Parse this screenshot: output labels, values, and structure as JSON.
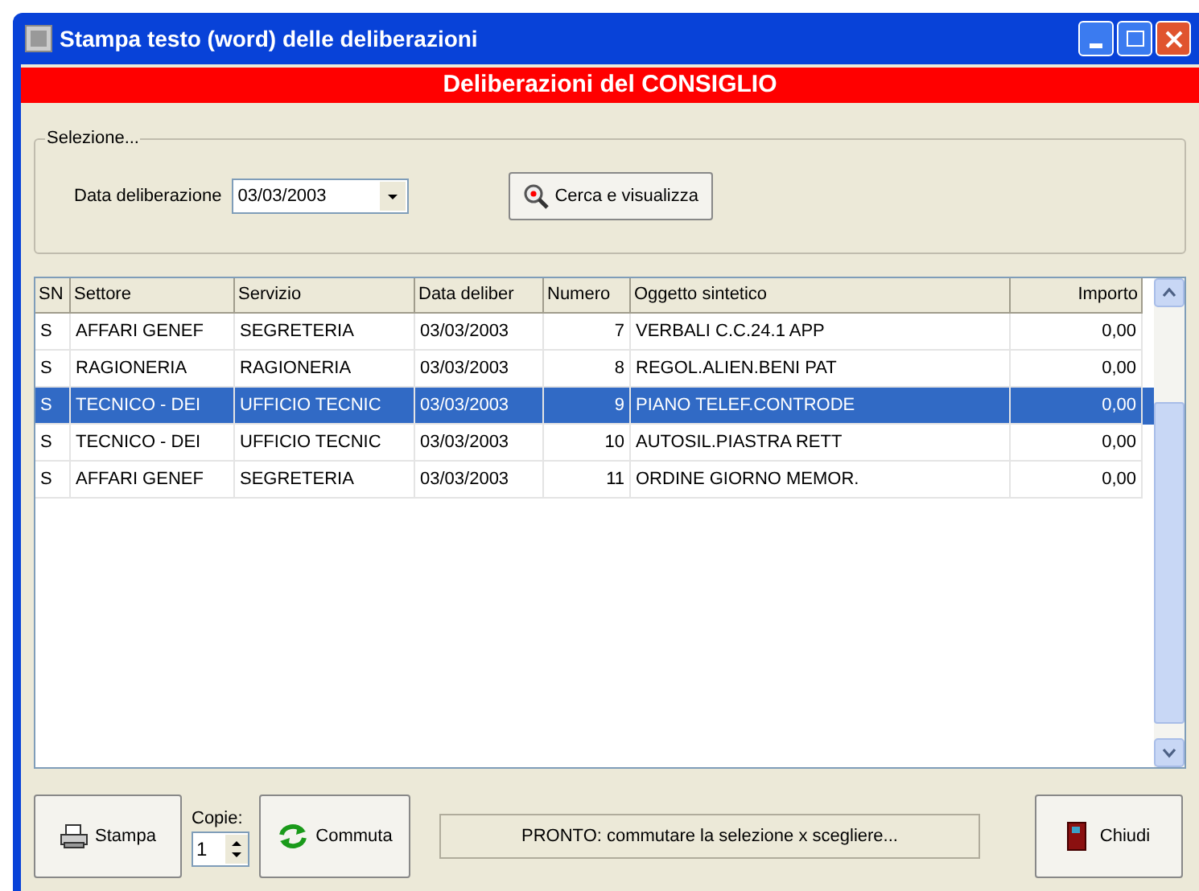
{
  "window": {
    "title": "Stampa testo (word) delle deliberazioni"
  },
  "banner": "Deliberazioni del CONSIGLIO",
  "selection": {
    "legend": "Selezione...",
    "date_label": "Data deliberazione",
    "date_value": "03/03/2003",
    "search_button": "Cerca e visualizza"
  },
  "table": {
    "columns": [
      "SN",
      "Settore",
      "Servizio",
      "Data deliber",
      "Numero",
      "Oggetto sintetico",
      "Importo"
    ],
    "rows": [
      {
        "selected": false,
        "cells": [
          "S",
          "AFFARI GENEF",
          "SEGRETERIA",
          "03/03/2003",
          "7",
          "VERBALI C.C.24.1 APP",
          "0,00"
        ]
      },
      {
        "selected": false,
        "cells": [
          "S",
          "RAGIONERIA",
          "RAGIONERIA",
          "03/03/2003",
          "8",
          "REGOL.ALIEN.BENI PAT",
          "0,00"
        ]
      },
      {
        "selected": true,
        "cells": [
          "S",
          "TECNICO - DEI",
          "UFFICIO TECNIC",
          "03/03/2003",
          "9",
          "PIANO TELEF.CONTRODE",
          "0,00"
        ]
      },
      {
        "selected": false,
        "cells": [
          "S",
          "TECNICO - DEI",
          "UFFICIO TECNIC",
          "03/03/2003",
          "10",
          "AUTOSIL.PIASTRA RETT",
          "0,00"
        ]
      },
      {
        "selected": false,
        "cells": [
          "S",
          "AFFARI GENEF",
          "SEGRETERIA",
          "03/03/2003",
          "11",
          "ORDINE GIORNO MEMOR.",
          "0,00"
        ]
      }
    ]
  },
  "footer": {
    "print_button": "Stampa",
    "copies_label": "Copie:",
    "copies_value": "1",
    "toggle_button": "Commuta",
    "status": "PRONTO: commutare la selezione x scegliere...",
    "close_button": "Chiudi"
  }
}
